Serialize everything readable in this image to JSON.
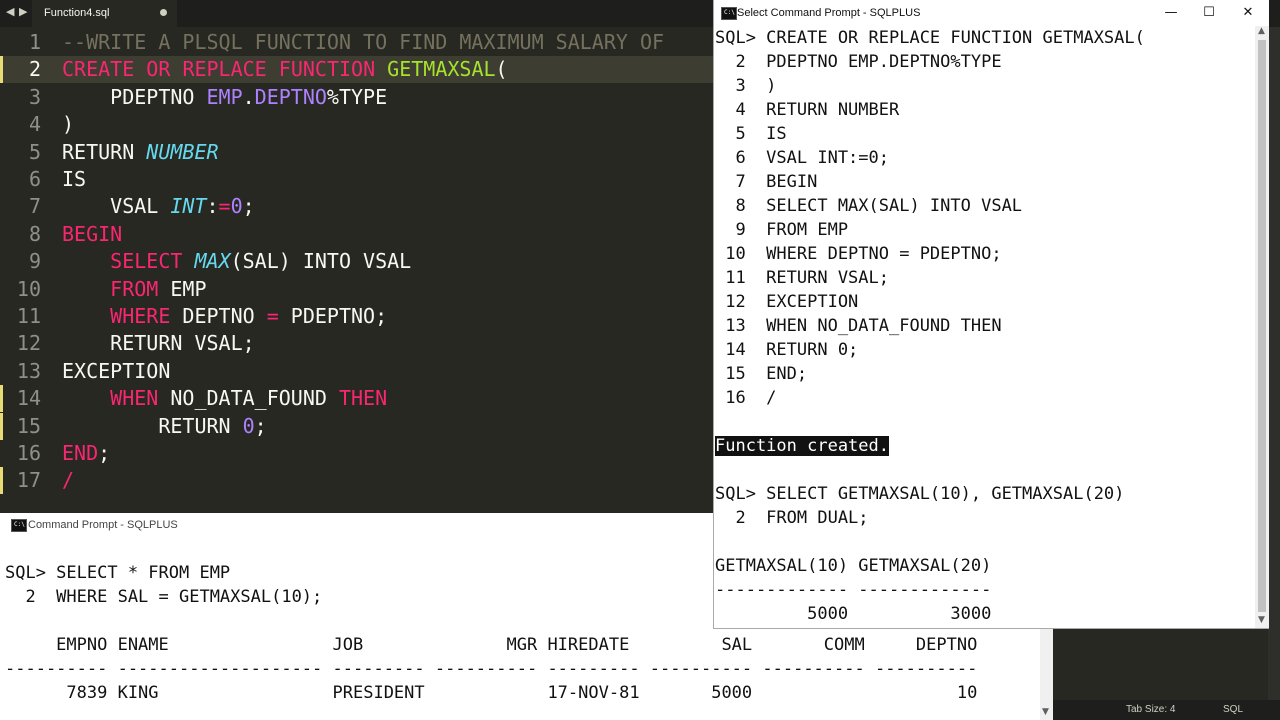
{
  "editor": {
    "tab": {
      "label": "Function4.sql"
    },
    "nav": {
      "back": "◀",
      "forward": "▶"
    },
    "lines": [
      {
        "num": "1",
        "tokens": [
          {
            "t": "--WRITE A PLSQL FUNCTION TO FIND MAXIMUM SALARY OF",
            "c": "cmt"
          }
        ]
      },
      {
        "num": "2",
        "tokens": [
          {
            "t": "CREATE",
            "c": "kw"
          },
          {
            "t": " ",
            "c": "tx"
          },
          {
            "t": "OR",
            "c": "kw"
          },
          {
            "t": " ",
            "c": "tx"
          },
          {
            "t": "REPLACE",
            "c": "kw"
          },
          {
            "t": " ",
            "c": "tx"
          },
          {
            "t": "FUNCTION",
            "c": "kw"
          },
          {
            "t": " ",
            "c": "tx"
          },
          {
            "t": "GETMAXSAL",
            "c": "fn"
          },
          {
            "t": "(",
            "c": "tx"
          }
        ]
      },
      {
        "num": "3",
        "tokens": [
          {
            "t": "    PDEPTNO ",
            "c": "tx"
          },
          {
            "t": "EMP",
            "c": "col"
          },
          {
            "t": ".",
            "c": "tx"
          },
          {
            "t": "DEPTNO",
            "c": "col"
          },
          {
            "t": "%TYPE",
            "c": "tx"
          }
        ]
      },
      {
        "num": "4",
        "tokens": [
          {
            "t": ")",
            "c": "tx"
          }
        ]
      },
      {
        "num": "5",
        "tokens": [
          {
            "t": "RETURN ",
            "c": "tx"
          },
          {
            "t": "NUMBER",
            "c": "ty"
          }
        ]
      },
      {
        "num": "6",
        "tokens": [
          {
            "t": "IS",
            "c": "tx"
          }
        ]
      },
      {
        "num": "7",
        "tokens": [
          {
            "t": "    VSAL ",
            "c": "tx"
          },
          {
            "t": "INT",
            "c": "ty"
          },
          {
            "t": ":",
            "c": "tx"
          },
          {
            "t": "=",
            "c": "kw"
          },
          {
            "t": "0",
            "c": "num"
          },
          {
            "t": ";",
            "c": "tx"
          }
        ]
      },
      {
        "num": "8",
        "tokens": [
          {
            "t": "BEGIN",
            "c": "kw"
          }
        ]
      },
      {
        "num": "9",
        "tokens": [
          {
            "t": "    ",
            "c": "tx"
          },
          {
            "t": "SELECT",
            "c": "kw"
          },
          {
            "t": " ",
            "c": "tx"
          },
          {
            "t": "MAX",
            "c": "fn2"
          },
          {
            "t": "(SAL) INTO VSAL",
            "c": "tx"
          }
        ]
      },
      {
        "num": "10",
        "tokens": [
          {
            "t": "    ",
            "c": "tx"
          },
          {
            "t": "FROM",
            "c": "kw"
          },
          {
            "t": " EMP",
            "c": "tx"
          }
        ]
      },
      {
        "num": "11",
        "tokens": [
          {
            "t": "    ",
            "c": "tx"
          },
          {
            "t": "WHERE",
            "c": "kw"
          },
          {
            "t": " DEPTNO ",
            "c": "tx"
          },
          {
            "t": "=",
            "c": "kw"
          },
          {
            "t": " PDEPTNO;",
            "c": "tx"
          }
        ]
      },
      {
        "num": "12",
        "tokens": [
          {
            "t": "    RETURN VSAL;",
            "c": "tx"
          }
        ]
      },
      {
        "num": "13",
        "tokens": [
          {
            "t": "EXCEPTION",
            "c": "tx"
          }
        ]
      },
      {
        "num": "14",
        "tokens": [
          {
            "t": "    ",
            "c": "tx"
          },
          {
            "t": "WHEN",
            "c": "kw"
          },
          {
            "t": " NO_DATA_FOUND ",
            "c": "tx"
          },
          {
            "t": "THEN",
            "c": "kw"
          }
        ]
      },
      {
        "num": "15",
        "tokens": [
          {
            "t": "        RETURN ",
            "c": "tx"
          },
          {
            "t": "0",
            "c": "num"
          },
          {
            "t": ";",
            "c": "tx"
          }
        ]
      },
      {
        "num": "16",
        "tokens": [
          {
            "t": "END",
            "c": "kw"
          },
          {
            "t": ";",
            "c": "tx"
          }
        ]
      },
      {
        "num": "17",
        "tokens": [
          {
            "t": "/",
            "c": "kw"
          }
        ]
      }
    ],
    "current_line": "2",
    "modified_lines": [
      "2",
      "14",
      "15",
      "17"
    ]
  },
  "statusbar": {
    "tab_size": "Tab Size: 4",
    "syntax": "SQL"
  },
  "win1": {
    "title": "Select Command Prompt - SQLPLUS",
    "icon_text": "C:\\",
    "controls": {
      "minimize": "—",
      "maximize": "☐",
      "close": "✕"
    },
    "lines": [
      "SQL> CREATE OR REPLACE FUNCTION GETMAXSAL(",
      "  2  PDEPTNO EMP.DEPTNO%TYPE",
      "  3  )",
      "  4  RETURN NUMBER",
      "  5  IS",
      "  6  VSAL INT:=0;",
      "  7  BEGIN",
      "  8  SELECT MAX(SAL) INTO VSAL",
      "  9  FROM EMP",
      " 10  WHERE DEPTNO = PDEPTNO;",
      " 11  RETURN VSAL;",
      " 12  EXCEPTION",
      " 13  WHEN NO_DATA_FOUND THEN",
      " 14  RETURN 0;",
      " 15  END;",
      " 16  /",
      "",
      "Function created.",
      "",
      "SQL> SELECT GETMAXSAL(10), GETMAXSAL(20)",
      "  2  FROM DUAL;",
      "",
      "GETMAXSAL(10) GETMAXSAL(20)",
      "------------- -------------",
      "         5000          3000"
    ],
    "highlighted_line_index": 17
  },
  "win2": {
    "title": "Command Prompt - SQLPLUS",
    "icon_text": "C:\\",
    "lines": [
      "",
      "SQL> SELECT * FROM EMP",
      "  2  WHERE SAL = GETMAXSAL(10);",
      "",
      "     EMPNO ENAME                JOB              MGR HIREDATE         SAL       COMM     DEPTNO",
      "---------- -------------------- --------- ---------- --------- ---------- ---------- ----------",
      "      7839 KING                 PRESIDENT            17-NOV-81       5000                    10"
    ]
  },
  "colors": {
    "editor_bg": "#272822",
    "keyword": "#f92672",
    "function": "#a6e22e",
    "type": "#66d9ef",
    "column": "#ae81ff",
    "comment": "#75715e",
    "modified_marker": "#e6db74"
  }
}
